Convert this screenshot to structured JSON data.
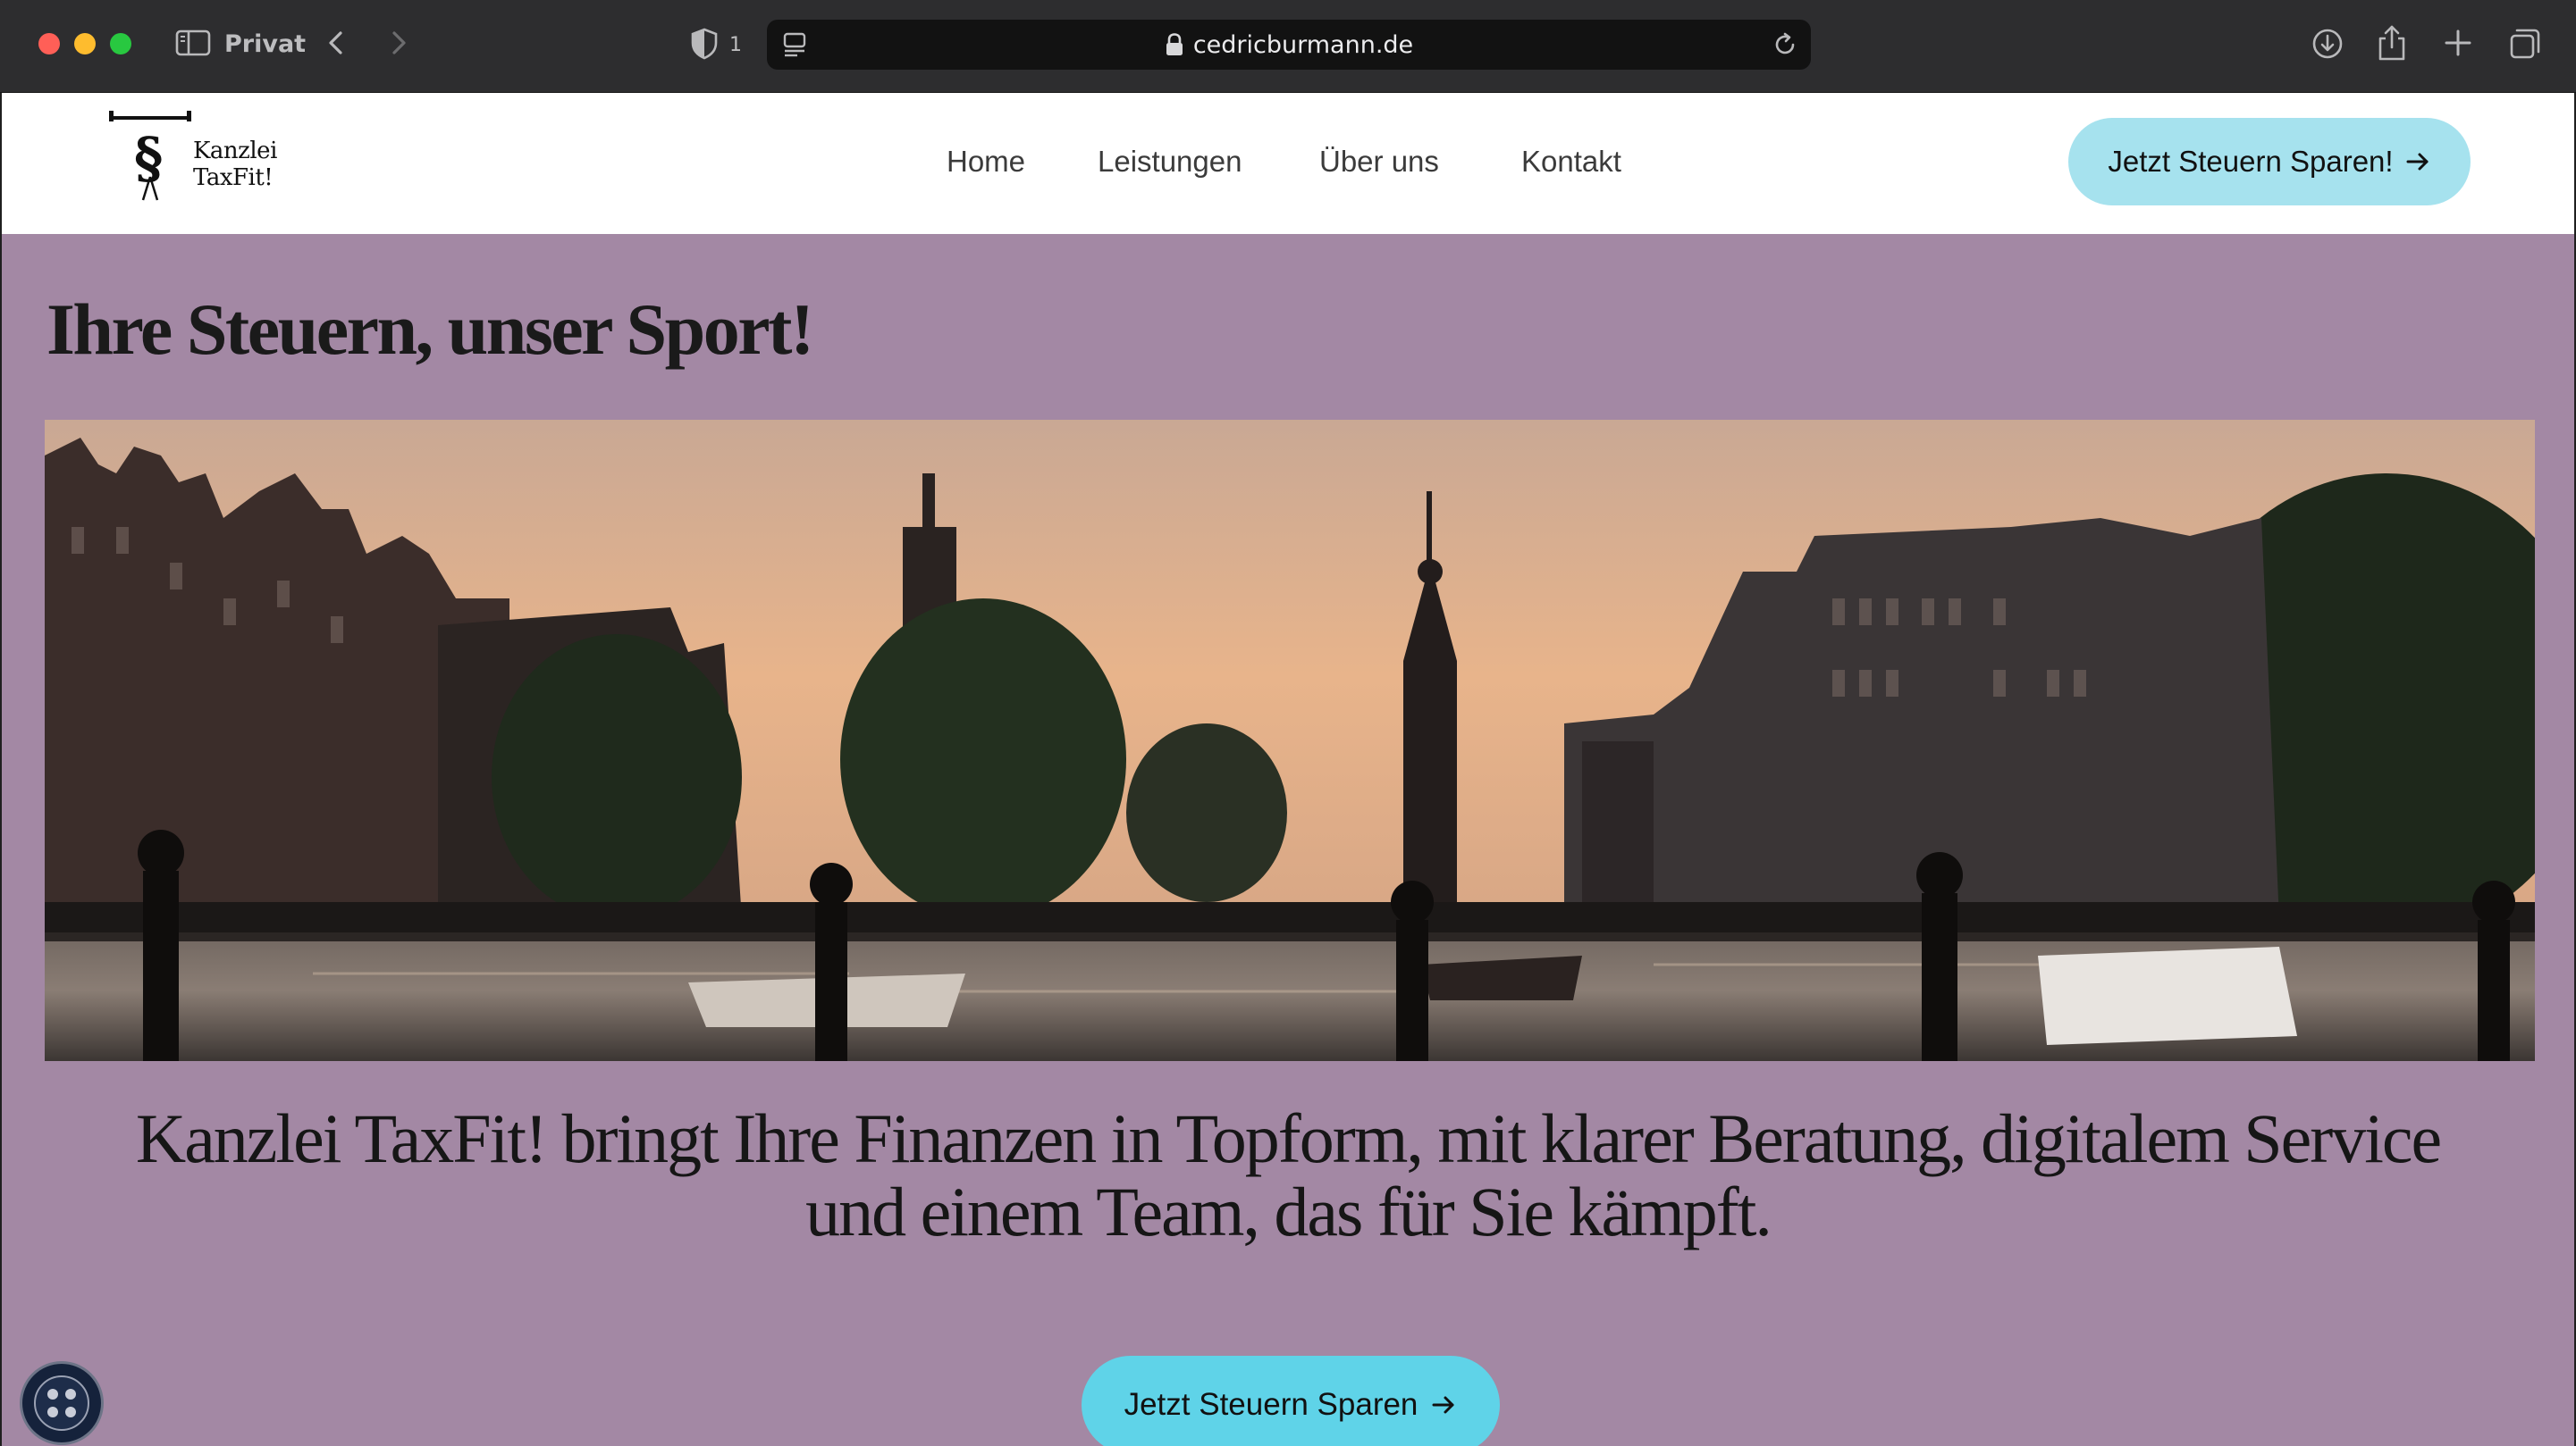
{
  "browser": {
    "profile_label": "Privat",
    "tracker_count": "1",
    "url": "cedricburmann.de"
  },
  "header": {
    "logo_text": "Kanzlei TaxFit!",
    "nav": [
      {
        "label": "Home"
      },
      {
        "label": "Leistungen"
      },
      {
        "label": "Über uns"
      },
      {
        "label": "Kontakt"
      }
    ],
    "cta_label": "Jetzt Steuern Sparen!"
  },
  "hero": {
    "title": "Ihre Steuern, unser Sport!",
    "text_line1": "Kanzlei TaxFit! bringt Ihre Finanzen in Topform, mit klarer Beratung, digitalem Service",
    "text_line2": "und einem Team, das für Sie kämpft.",
    "cta_label": "Jetzt Steuern Sparen"
  },
  "colors": {
    "page_background": "#a388a4",
    "header_cta": "#a6e2ee",
    "main_cta": "#5fd3e8",
    "chrome": "#2d2d2f"
  },
  "icons": [
    "sidebar-icon",
    "back-icon",
    "forward-icon",
    "shield-icon",
    "page-menu-icon",
    "lock-icon",
    "reload-icon",
    "download-icon",
    "share-icon",
    "new-tab-icon",
    "tab-overview-icon",
    "arrow-right-icon",
    "cookie-icon"
  ]
}
